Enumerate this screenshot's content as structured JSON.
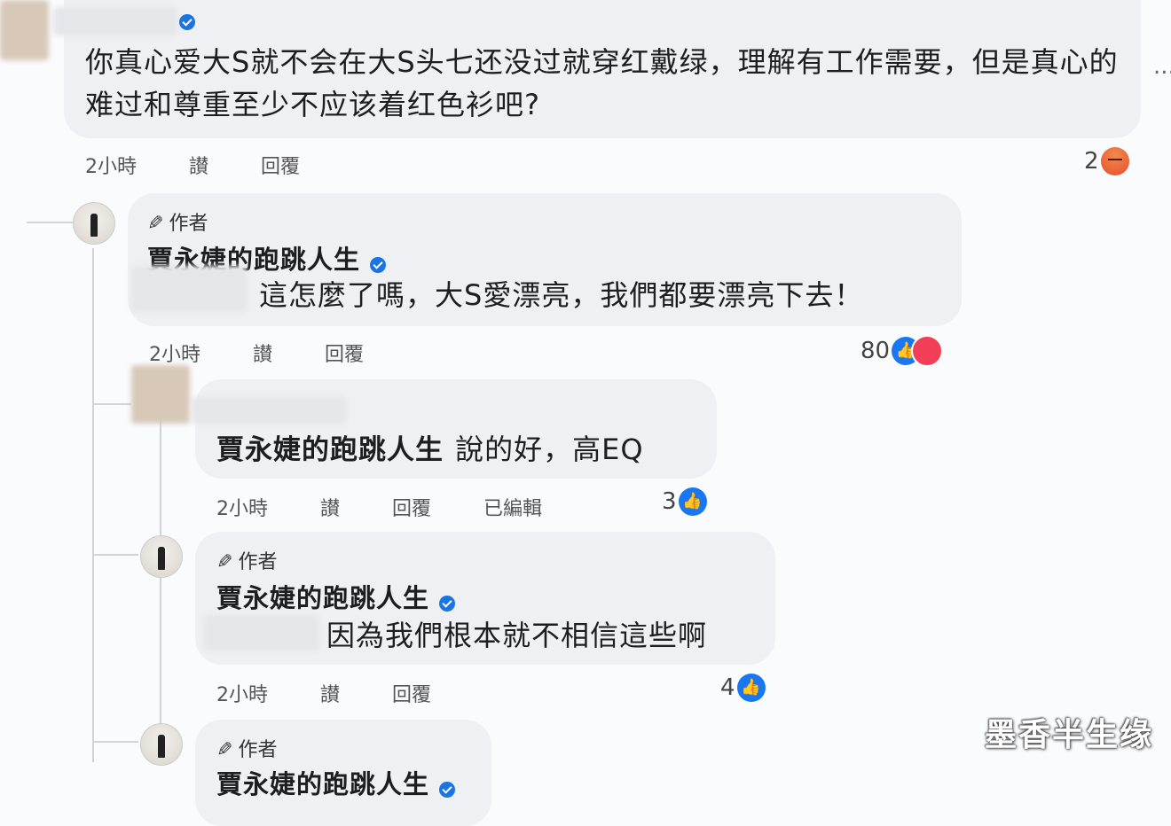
{
  "top_comment": {
    "text": "你真心爱大S就不会在大S头七还没过就穿红戴绿，理解有工作需要，但是真心的难过和尊重至少不应该着红色衫吧?",
    "time": "2小時",
    "like_label": "讃",
    "reply_label": "回覆",
    "reaction_count": "2",
    "more_label": "..."
  },
  "reply1": {
    "author_tag": "作者",
    "name": "賈永婕的跑跳人生",
    "text": "這怎麼了嗎，大S愛漂亮，我們都要漂亮下去！",
    "time": "2小時",
    "like_label": "讃",
    "reply_label": "回覆",
    "reaction_count": "80"
  },
  "reply2": {
    "text_name": "賈永婕的跑跳人生",
    "text": "說的好，高EQ",
    "time": "2小時",
    "like_label": "讃",
    "reply_label": "回覆",
    "edited_label": "已編輯",
    "reaction_count": "3"
  },
  "reply3": {
    "author_tag": "作者",
    "name": "賈永婕的跑跳人生",
    "text": "因為我們根本就不相信這些啊",
    "time": "2小時",
    "like_label": "讃",
    "reply_label": "回覆",
    "reaction_count": "4"
  },
  "reply4": {
    "author_tag": "作者",
    "name": "賈永婕的跑跳人生"
  },
  "watermark": "墨香半生缘",
  "icons": {
    "like": "thumbs-up-icon",
    "angry": "angry-reaction-icon",
    "love": "love-reaction-icon",
    "verified": "verified-badge-icon",
    "pencil": "pencil-icon"
  },
  "colors": {
    "bubble": "#eef0f4",
    "verified": "#1b74e4",
    "like": "#1877f2",
    "love": "#f33e58",
    "angry": "#e84e2c"
  }
}
